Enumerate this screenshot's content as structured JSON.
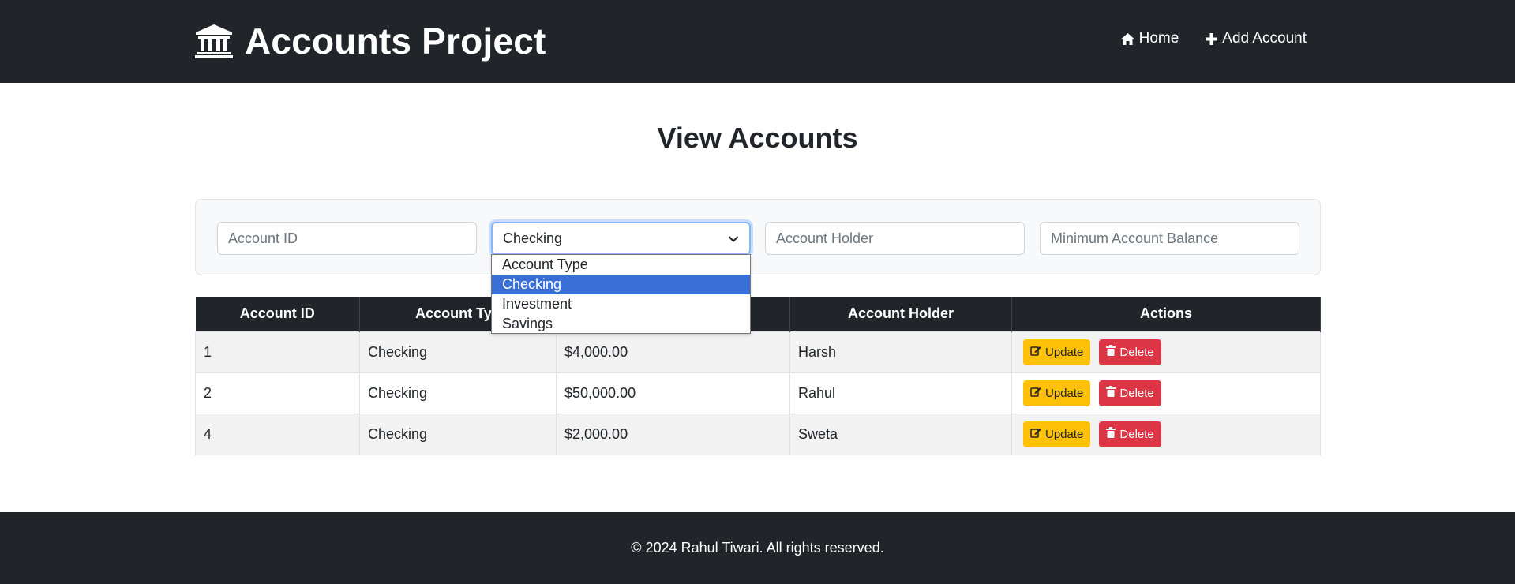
{
  "header": {
    "brand": "Accounts Project",
    "nav": [
      {
        "label": "Home",
        "icon": "home-icon"
      },
      {
        "label": "Add Account",
        "icon": "plus-icon"
      }
    ]
  },
  "main": {
    "title": "View Accounts",
    "filters": {
      "account_id_placeholder": "Account ID",
      "account_type_selected": "Checking",
      "account_holder_placeholder": "Account Holder",
      "min_balance_placeholder": "Minimum Account Balance"
    },
    "dropdown_options": [
      "Account Type",
      "Checking",
      "Investment",
      "Savings"
    ],
    "dropdown_selected_index": 1,
    "table": {
      "headers": [
        "Account ID",
        "Account Typ",
        "",
        "Account Holder",
        "Actions"
      ],
      "rows": [
        {
          "id": "1",
          "type": "Checking",
          "balance": "$4,000.00",
          "holder": "Harsh"
        },
        {
          "id": "2",
          "type": "Checking",
          "balance": "$50,000.00",
          "holder": "Rahul"
        },
        {
          "id": "4",
          "type": "Checking",
          "balance": "$2,000.00",
          "holder": "Sweta"
        }
      ],
      "update_label": "Update",
      "delete_label": "Delete"
    }
  },
  "footer": {
    "text": "© 2024 Rahul Tiwari. All rights reserved."
  },
  "colors": {
    "header_bg": "#212529",
    "update_button": "#ffc107",
    "delete_button": "#dc3545",
    "dropdown_highlight": "#3a6fd8"
  }
}
